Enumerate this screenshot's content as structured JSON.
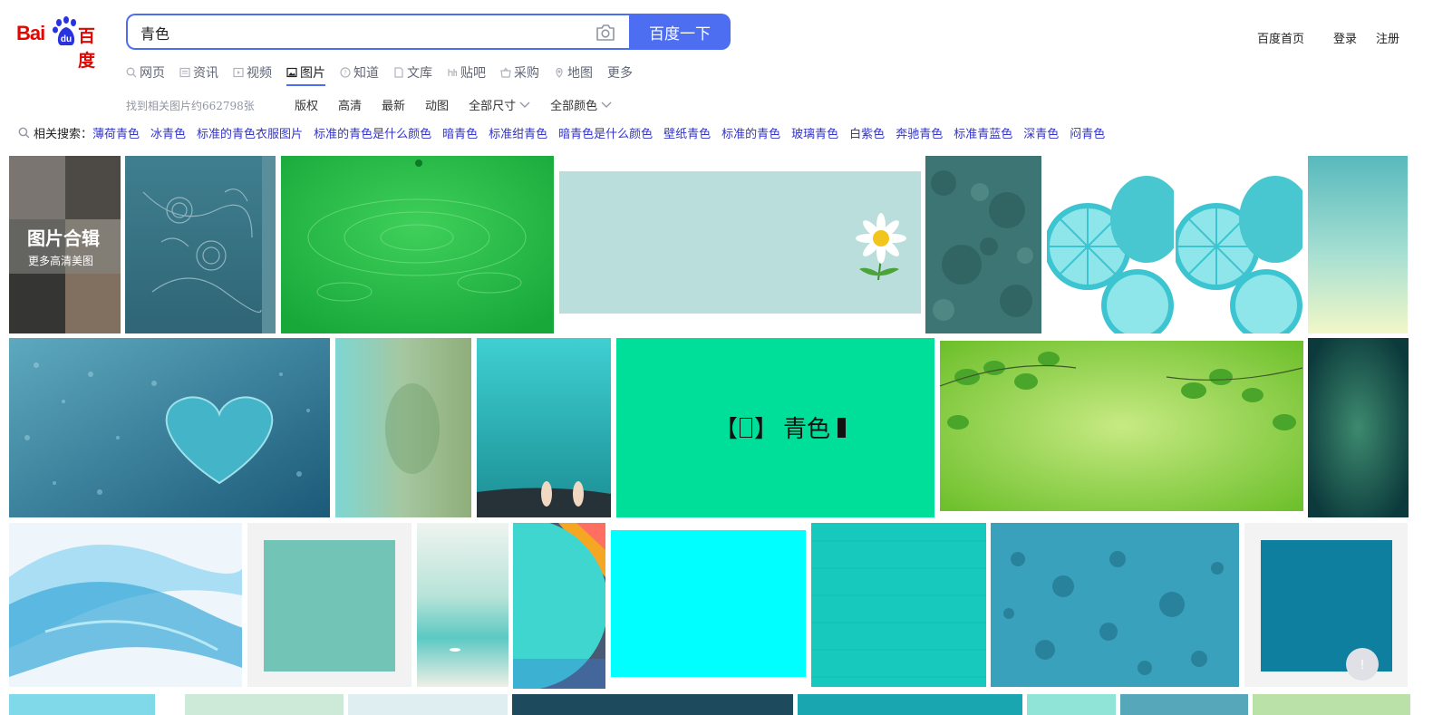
{
  "logo": {
    "bai": "Bai",
    "du": "du",
    "cn": "百度"
  },
  "search": {
    "query": "青色",
    "button_label": "百度一下",
    "camera_icon": "camera-icon"
  },
  "top_links": {
    "home": "百度首页",
    "login": "登录",
    "register": "注册"
  },
  "nav_tabs": [
    {
      "label": "网页",
      "icon": "search-icon",
      "active": false
    },
    {
      "label": "资讯",
      "icon": "news-icon",
      "active": false
    },
    {
      "label": "视频",
      "icon": "video-icon",
      "active": false
    },
    {
      "label": "图片",
      "icon": "image-icon",
      "active": true
    },
    {
      "label": "知道",
      "icon": "question-icon",
      "active": false
    },
    {
      "label": "文库",
      "icon": "document-icon",
      "active": false
    },
    {
      "label": "贴吧",
      "icon": "tieba-icon",
      "active": false
    },
    {
      "label": "采购",
      "icon": "basket-icon",
      "active": false
    },
    {
      "label": "地图",
      "icon": "map-icon",
      "active": false
    },
    {
      "label": "更多",
      "icon": "",
      "active": false
    }
  ],
  "result_count": "找到相关图片约662798张",
  "filters": [
    {
      "label": "版权",
      "dropdown": false
    },
    {
      "label": "高清",
      "dropdown": false
    },
    {
      "label": "最新",
      "dropdown": false
    },
    {
      "label": "动图",
      "dropdown": false
    },
    {
      "label": "全部尺寸",
      "dropdown": true
    },
    {
      "label": "全部颜色",
      "dropdown": true
    }
  ],
  "related": {
    "label": "相关搜索：",
    "items": [
      "薄荷青色",
      "冰青色",
      "标准的青色衣服图片",
      "标准的青色是什么颜色",
      "暗青色",
      "标准绀青色",
      "暗青色是什么颜色",
      "壁纸青色",
      "标准的青色",
      "玻璃青色",
      "白紫色",
      "奔驰青色",
      "标准青蓝色",
      "深青色",
      "闷青色"
    ]
  },
  "album": {
    "title": "图片合辑",
    "subtitle": "更多高清美图"
  },
  "tiles": {
    "qingse_card_text": "青色",
    "stamp_text": "青色"
  },
  "feedback_label": "!",
  "colors": {
    "accent": "#4e6ef2",
    "logo_red": "#e10602",
    "logo_blue": "#2932e1",
    "related_link": "#3334cc"
  }
}
